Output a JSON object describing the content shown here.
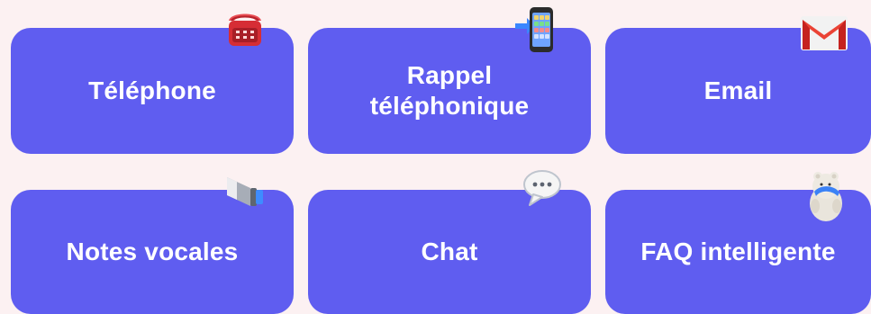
{
  "cards": [
    {
      "label": "Téléphone",
      "icon": "telephone-icon"
    },
    {
      "label": "Rappel téléphonique",
      "icon": "mobile-callback-icon"
    },
    {
      "label": "Email",
      "icon": "gmail-icon"
    },
    {
      "label": "Notes vocales",
      "icon": "megaphone-icon"
    },
    {
      "label": "Chat",
      "icon": "speech-bubble-icon"
    },
    {
      "label": "FAQ intelligente",
      "icon": "polar-bear-icon"
    }
  ],
  "colors": {
    "background": "#fcf1f2",
    "card": "#5f5df0",
    "text": "#ffffff"
  }
}
